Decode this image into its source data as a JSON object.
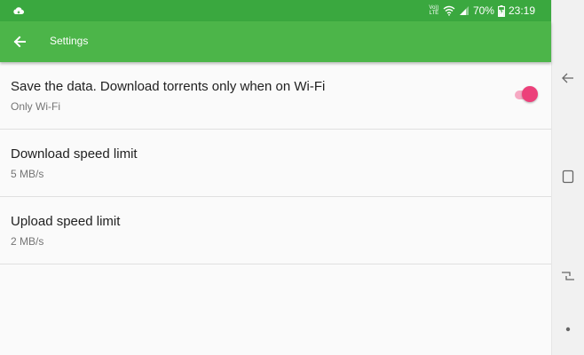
{
  "status_bar": {
    "volte_line1": "Vo))",
    "volte_line2": "LTE",
    "battery_percent": "70%",
    "time": "23:19",
    "icons": [
      "cloud-icon",
      "wifi-icon",
      "signal-icon",
      "battery-charging-icon"
    ]
  },
  "toolbar": {
    "title": "Settings",
    "back_icon": "arrow-left-icon"
  },
  "settings": [
    {
      "title": "Save the data. Download torrents only when on Wi-Fi",
      "summary": "Only Wi-Fi",
      "toggle": true
    },
    {
      "title": "Download speed limit",
      "summary": "5 MB/s"
    },
    {
      "title": "Upload speed limit",
      "summary": "2 MB/s"
    }
  ],
  "colors": {
    "status_bar": "#3aa83f",
    "toolbar": "#4cb549",
    "accent": "#ec407a"
  },
  "nav_bar": {
    "icons": [
      "back-icon",
      "home-icon",
      "recents-icon",
      "dot-icon"
    ]
  }
}
